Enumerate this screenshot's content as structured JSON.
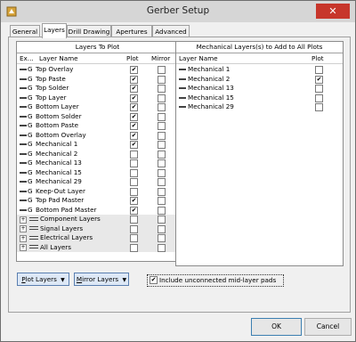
{
  "window": {
    "title": "Gerber Setup",
    "close_glyph": "✕"
  },
  "tabs": [
    "General",
    "Layers",
    "Drill Drawing",
    "Apertures",
    "Advanced"
  ],
  "active_tab": "Layers",
  "layers_to_plot": {
    "header": "Layers To Plot",
    "columns": {
      "ext": "Ex...",
      "name": "Layer Name",
      "plot": "Plot",
      "mirror": "Mirror"
    },
    "rows": [
      {
        "ext": "G",
        "name": "Top Overlay",
        "plot": true,
        "mirror": false
      },
      {
        "ext": "G",
        "name": "Top Paste",
        "plot": true,
        "mirror": false
      },
      {
        "ext": "G",
        "name": "Top Solder",
        "plot": true,
        "mirror": false
      },
      {
        "ext": "G",
        "name": "Top Layer",
        "plot": true,
        "mirror": false
      },
      {
        "ext": "G",
        "name": "Bottom Layer",
        "plot": true,
        "mirror": false
      },
      {
        "ext": "G",
        "name": "Bottom Solder",
        "plot": true,
        "mirror": false
      },
      {
        "ext": "G",
        "name": "Bottom Paste",
        "plot": true,
        "mirror": false
      },
      {
        "ext": "G",
        "name": "Bottom Overlay",
        "plot": true,
        "mirror": false
      },
      {
        "ext": "G",
        "name": "Mechanical 1",
        "plot": true,
        "mirror": false
      },
      {
        "ext": "G",
        "name": "Mechanical 2",
        "plot": false,
        "mirror": false
      },
      {
        "ext": "G",
        "name": "Mechanical 13",
        "plot": false,
        "mirror": false
      },
      {
        "ext": "G",
        "name": "Mechanical 15",
        "plot": false,
        "mirror": false
      },
      {
        "ext": "G",
        "name": "Mechanical 29",
        "plot": false,
        "mirror": false
      },
      {
        "ext": "G",
        "name": "Keep-Out Layer",
        "plot": false,
        "mirror": false
      },
      {
        "ext": "G",
        "name": "Top Pad Master",
        "plot": true,
        "mirror": false
      },
      {
        "ext": "G",
        "name": "Bottom Pad Master",
        "plot": true,
        "mirror": false
      }
    ],
    "groups": [
      {
        "name": "Component Layers",
        "plot": false,
        "mirror": false
      },
      {
        "name": "Signal Layers",
        "plot": false,
        "mirror": false
      },
      {
        "name": "Electrical Layers",
        "plot": false,
        "mirror": false
      },
      {
        "name": "All Layers",
        "plot": false,
        "mirror": false
      }
    ]
  },
  "mechanical": {
    "header": "Mechanical Layers(s) to Add to All Plots",
    "columns": {
      "name": "Layer Name",
      "plot": "Plot"
    },
    "rows": [
      {
        "name": "Mechanical 1",
        "plot": false
      },
      {
        "name": "Mechanical 2",
        "plot": true
      },
      {
        "name": "Mechanical 13",
        "plot": false
      },
      {
        "name": "Mechanical 15",
        "plot": false
      },
      {
        "name": "Mechanical 29",
        "plot": false
      }
    ]
  },
  "controls": {
    "plot_layers": {
      "underlined": "P",
      "rest": "lot Layers",
      "arrow": "▼"
    },
    "mirror_layers": {
      "underlined": "M",
      "rest": "irror Layers",
      "arrow": "▼"
    },
    "include_unconnected": {
      "label": "Include unconnected mid-layer pads",
      "checked": true
    }
  },
  "footer": {
    "ok": "OK",
    "cancel": "Cancel"
  },
  "check_glyph": "✔",
  "plus_glyph": "+",
  "colors": {
    "close_bg": "#c7362b",
    "button_accent": "#5a7fb0"
  }
}
